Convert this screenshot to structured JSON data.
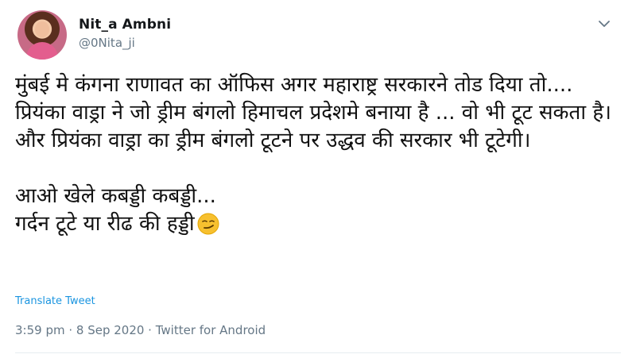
{
  "user": {
    "name": "Nit_a Ambni",
    "handle": "@0Nita_ji"
  },
  "menu": {
    "icon": "chevron-down-icon"
  },
  "tweet": {
    "text": "मुंबई मे कंगना राणावत का ऑफिस अगर महाराष्ट्र सरकारने तोड दिया तो.... प्रियंका वाड्रा ने जो ड्रीम बंगलो हिमाचल प्रदेशमे बनाया है ... वो भी टूट सकता है।\nऔर प्रियंका वाड्रा का ड्रीम बंगलो टूटने पर उद्धव की सरकार भी टूटेगी।\n\nआओ खेले कबड्डी कबड्डी...\nगर्दन टूटे या रीढ की हड्डी",
    "emoji": "smirking-face"
  },
  "actions": {
    "translate": "Translate Tweet"
  },
  "meta": {
    "timestamp": "3:59 pm · 8 Sep 2020 · Twitter for Android"
  },
  "colors": {
    "link": "#1b95e0",
    "secondary": "#657786",
    "text": "#111111"
  }
}
